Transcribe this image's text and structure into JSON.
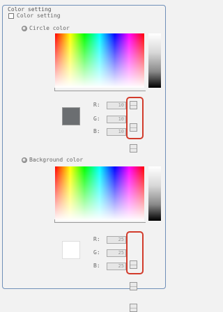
{
  "group": {
    "title": "Color setting"
  },
  "color_setting": {
    "label": "Color setting",
    "checked": false
  },
  "circle_color": {
    "label": "Circle color",
    "r_label": "R:",
    "g_label": "G:",
    "b_label": "B:",
    "r_value": "10",
    "g_value": "10",
    "b_value": "10",
    "swatch_color": "#6b6e71"
  },
  "background_color": {
    "label": "Background color",
    "r_label": "R:",
    "g_label": "G:",
    "b_label": "B:",
    "r_value": "25",
    "g_value": "25",
    "b_value": "25",
    "swatch_color": "#ffffff"
  },
  "colors": {
    "border": "#6f8fb8",
    "highlight": "#d23b2b"
  }
}
